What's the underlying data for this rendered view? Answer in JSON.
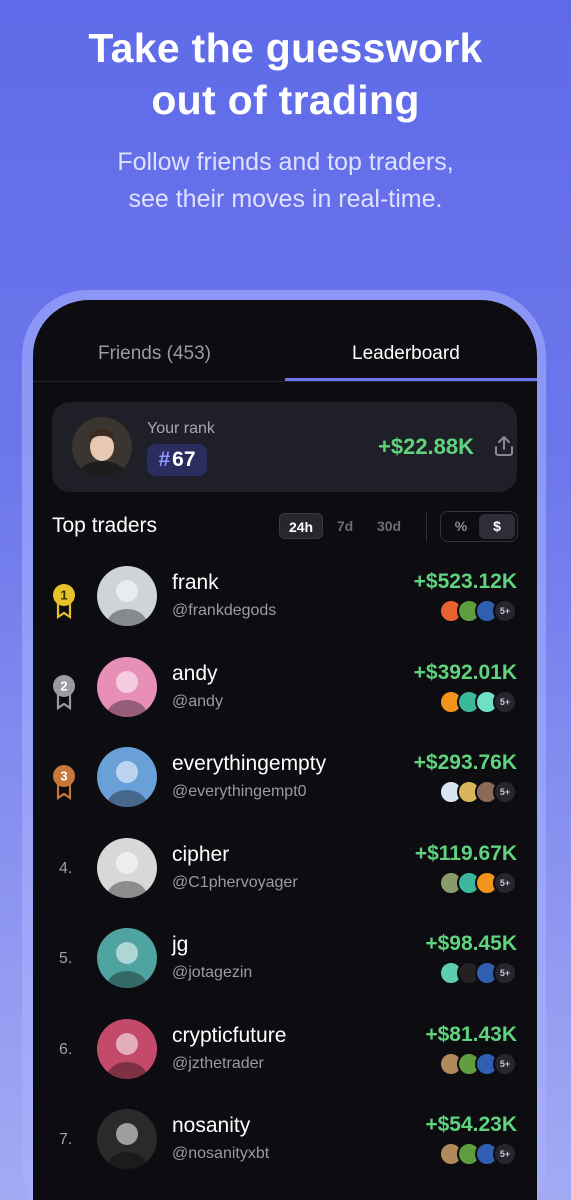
{
  "hero": {
    "title_line1": "Take the guesswork",
    "title_line2": "out of trading",
    "subtitle_line1": "Follow friends and top traders,",
    "subtitle_line2": "see their moves in real-time."
  },
  "tabs": [
    {
      "label": "Friends (453)",
      "active": false
    },
    {
      "label": "Leaderboard",
      "active": true
    }
  ],
  "your_rank": {
    "label": "Your rank",
    "hash": "#",
    "rank": "67",
    "pnl": "+$22.88K"
  },
  "top_traders": {
    "title": "Top traders",
    "timeframes": [
      {
        "label": "24h",
        "active": true
      },
      {
        "label": "7d",
        "active": false
      },
      {
        "label": "30d",
        "active": false
      }
    ],
    "units": [
      {
        "label": "%",
        "active": false
      },
      {
        "label": "$",
        "active": true
      }
    ]
  },
  "traders": [
    {
      "rank": "1",
      "medal": "gold",
      "name": "frank",
      "handle": "@frankdegods",
      "pnl": "+$523.12K",
      "more": "5+",
      "avatar_color": "#cfd4d8",
      "tokens": [
        "#e8622f",
        "#5f9d3f",
        "#2f5fb0"
      ]
    },
    {
      "rank": "2",
      "medal": "silver",
      "name": "andy",
      "handle": "@andy",
      "pnl": "+$392.01K",
      "more": "5+",
      "avatar_color": "#e88fb8",
      "tokens": [
        "#f2931b",
        "#3bb89c",
        "#6ee0c8"
      ]
    },
    {
      "rank": "3",
      "medal": "bronze",
      "name": "everythingempty",
      "handle": "@everythingempt0",
      "pnl": "+$293.76K",
      "more": "5+",
      "avatar_color": "#6aa0d8",
      "tokens": [
        "#d9e4f2",
        "#d8b55a",
        "#8b6a56"
      ]
    },
    {
      "rank": "4.",
      "medal": "",
      "name": "cipher",
      "handle": "@C1phervoyager",
      "pnl": "+$119.67K",
      "more": "5+",
      "avatar_color": "#d8d8d8",
      "tokens": [
        "#8a9a6a",
        "#3bb89c",
        "#f2931b"
      ]
    },
    {
      "rank": "5.",
      "medal": "",
      "name": "jg",
      "handle": "@jotagezin",
      "pnl": "+$98.45K",
      "more": "5+",
      "avatar_color": "#4fa3a0",
      "tokens": [
        "#5fcdb0",
        "#222222",
        "#2f5fb0"
      ]
    },
    {
      "rank": "6.",
      "medal": "",
      "name": "crypticfuture",
      "handle": "@jzthetrader",
      "pnl": "+$81.43K",
      "more": "5+",
      "avatar_color": "#c44a6a",
      "tokens": [
        "#b08a5a",
        "#5f9d3f",
        "#2f5fb0"
      ]
    },
    {
      "rank": "7.",
      "medal": "",
      "name": "nosanity",
      "handle": "@nosanityxbt",
      "pnl": "+$54.23K",
      "more": "5+",
      "avatar_color": "#2a2a2a",
      "tokens": [
        "#b08a5a",
        "#5f9d3f",
        "#2f5fb0"
      ]
    }
  ],
  "colors": {
    "accent": "#6c76f0",
    "positive": "#5fd37e",
    "gold": "#e8c22a",
    "silver": "#9b9ba4",
    "bronze": "#c7773a"
  }
}
